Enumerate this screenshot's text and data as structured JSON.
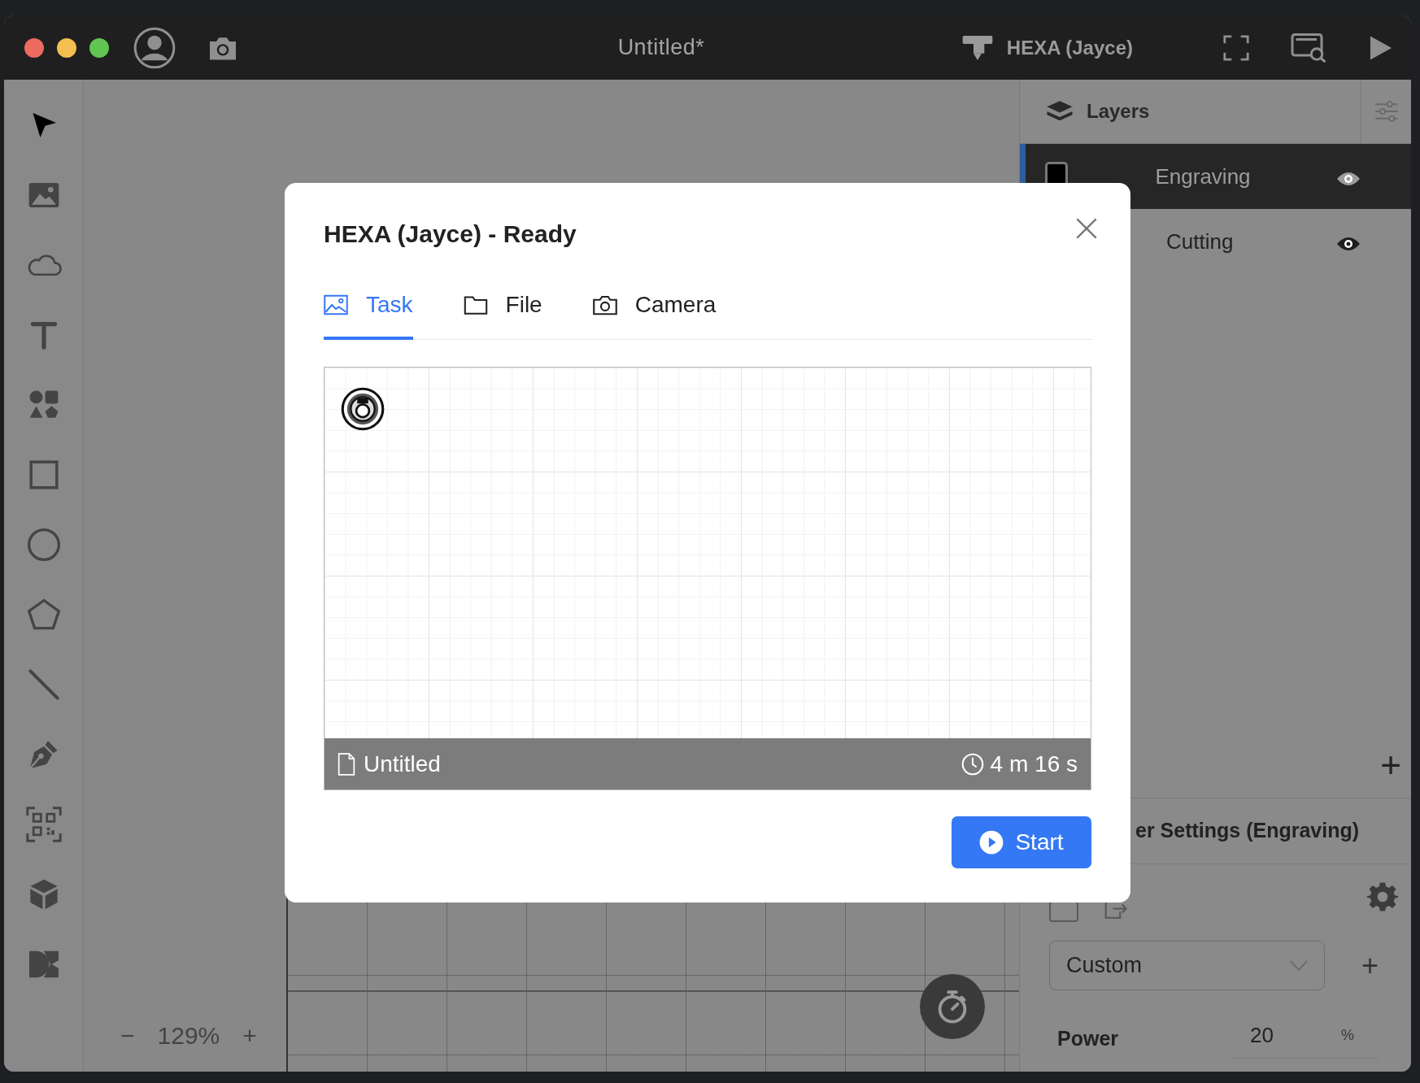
{
  "window": {
    "title": "Untitled*",
    "device": "HEXA (Jayce)"
  },
  "toolbar": {
    "tools": [
      {
        "selected": true
      },
      {
        "selected": false
      },
      {
        "selected": false
      },
      {
        "selected": false
      },
      {
        "selected": false
      },
      {
        "selected": false
      },
      {
        "selected": false
      },
      {
        "selected": false
      },
      {
        "selected": false
      },
      {
        "selected": false
      },
      {
        "selected": false
      },
      {
        "selected": false
      },
      {
        "selected": false
      }
    ]
  },
  "zoom": {
    "minus": "−",
    "value": "129%",
    "plus": "+"
  },
  "layers": {
    "title": "Layers",
    "add": "+",
    "items": [
      {
        "name": "Engraving",
        "selected": true,
        "visible": true
      },
      {
        "name": "Cutting",
        "selected": false,
        "visible": true
      }
    ]
  },
  "laser_settings": {
    "title": "er Settings (Engraving)",
    "preset": "Custom",
    "add": "+",
    "power": {
      "label": "Power",
      "value": "20",
      "unit": "%"
    }
  },
  "dialog": {
    "title": "HEXA (Jayce) - Ready",
    "tabs": [
      {
        "label": "Task",
        "selected": true
      },
      {
        "label": "File",
        "selected": false
      },
      {
        "label": "Camera",
        "selected": false
      }
    ],
    "preview": {
      "file_name": "Untitled",
      "duration": "4 m 16 s"
    },
    "start_button": "Start"
  }
}
